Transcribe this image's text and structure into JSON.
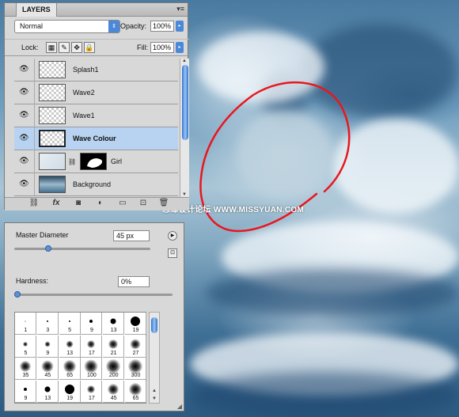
{
  "layers_panel": {
    "tab": "LAYERS",
    "menu_icon": "panel-menu-icon",
    "blend_mode": "Normal",
    "opacity_label": "Opacity:",
    "opacity_value": "100%",
    "lock_label": "Lock:",
    "fill_label": "Fill:",
    "fill_value": "100%",
    "layers": [
      {
        "name": "Splash1",
        "type": "transparent",
        "selected": false
      },
      {
        "name": "Wave2",
        "type": "transparent",
        "selected": false
      },
      {
        "name": "Wave1",
        "type": "transparent",
        "selected": false
      },
      {
        "name": "Wave Colour",
        "type": "transparent",
        "selected": true
      },
      {
        "name": "Girl",
        "type": "masked",
        "selected": false
      },
      {
        "name": "Background",
        "type": "image",
        "selected": false
      }
    ],
    "bottom_icons": [
      "link-icon",
      "fx-icon",
      "mask-icon",
      "adjustment-icon",
      "group-icon",
      "new-layer-icon",
      "trash-icon"
    ],
    "fx_label": "fx"
  },
  "brushes_panel": {
    "master_diameter_label": "Master Diameter",
    "master_diameter_value": "45 px",
    "master_diameter_fraction": 0.25,
    "hardness_label": "Hardness:",
    "hardness_value": "0%",
    "hardness_fraction": 0.0,
    "presets": [
      {
        "label": "1",
        "size": 1,
        "soft": false
      },
      {
        "label": "3",
        "size": 2,
        "soft": false
      },
      {
        "label": "5",
        "size": 2,
        "soft": false
      },
      {
        "label": "9",
        "size": 4,
        "soft": false
      },
      {
        "label": "13",
        "size": 7,
        "soft": false
      },
      {
        "label": "19",
        "size": 12,
        "soft": false
      },
      {
        "label": "5",
        "size": 2,
        "soft": true
      },
      {
        "label": "9",
        "size": 3,
        "soft": true
      },
      {
        "label": "13",
        "size": 5,
        "soft": true
      },
      {
        "label": "17",
        "size": 6,
        "soft": true
      },
      {
        "label": "21",
        "size": 8,
        "soft": true
      },
      {
        "label": "27",
        "size": 9,
        "soft": true
      },
      {
        "label": "35",
        "size": 10,
        "soft": true
      },
      {
        "label": "45",
        "size": 11,
        "soft": true
      },
      {
        "label": "65",
        "size": 12,
        "soft": true
      },
      {
        "label": "100",
        "size": 13,
        "soft": true
      },
      {
        "label": "200",
        "size": 14,
        "soft": true
      },
      {
        "label": "300",
        "size": 14,
        "soft": true
      },
      {
        "label": "9",
        "size": 4,
        "soft": false
      },
      {
        "label": "13",
        "size": 7,
        "soft": false
      },
      {
        "label": "19",
        "size": 12,
        "soft": false
      },
      {
        "label": "17",
        "size": 6,
        "soft": true
      },
      {
        "label": "45",
        "size": 10,
        "soft": true
      },
      {
        "label": "65",
        "size": 12,
        "soft": true
      }
    ]
  },
  "watermark": "思缘设计论坛 WWW.MISSYUAN.COM",
  "annotation_color": "#e8171f"
}
